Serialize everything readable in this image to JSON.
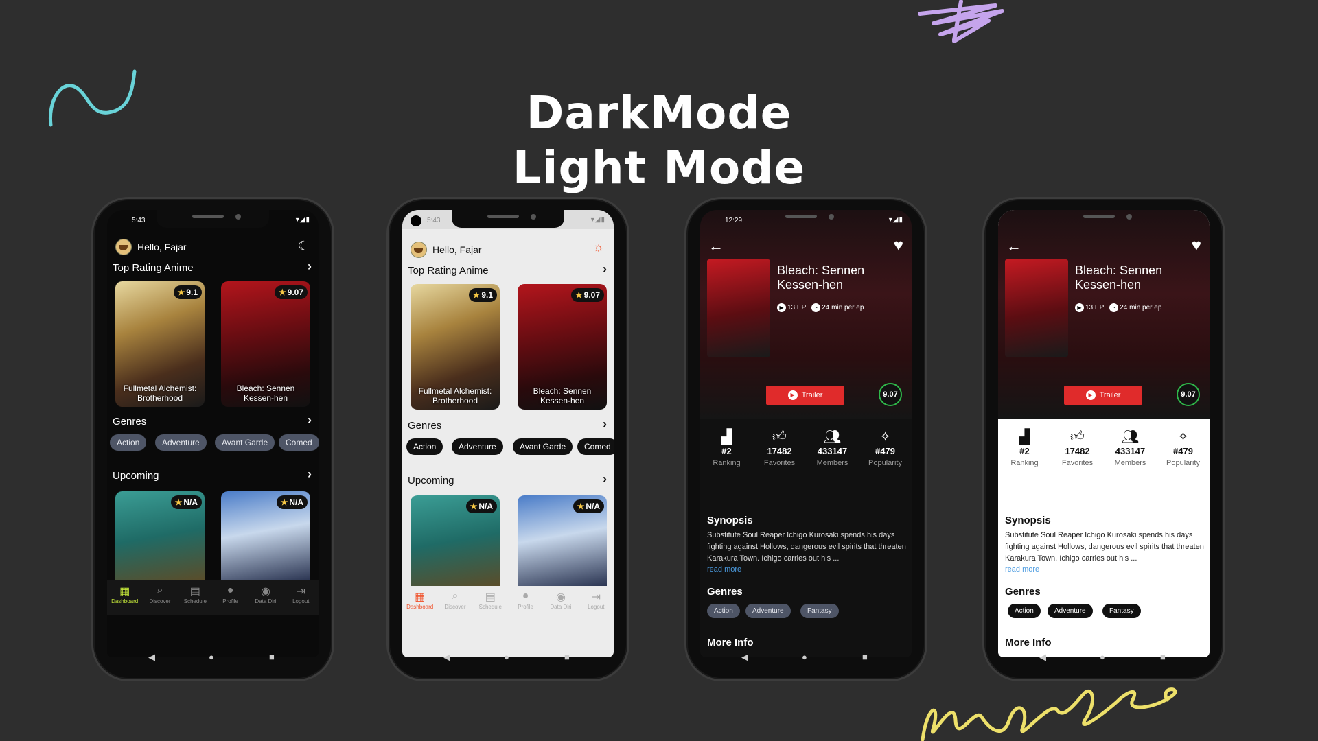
{
  "headline": {
    "line1": "DarkMode",
    "line2": "Light Mode"
  },
  "colors": {
    "background": "#2e2e2e",
    "accent_dark": "#c5e83a",
    "accent_light": "#f0532c",
    "trailer": "#e02b2b",
    "score_ring": "#2fb84a",
    "read_more": "#4b9be0"
  },
  "dashboard": {
    "time": "5:43",
    "greeting": "Hello, Fajar",
    "top_rating_title": "Top Rating Anime",
    "top_rating": [
      {
        "title": "Fullmetal Alchemist: Brotherhood",
        "rating": "9.1"
      },
      {
        "title": "Bleach: Sennen Kessen-hen",
        "rating": "9.07"
      }
    ],
    "genres_title": "Genres",
    "genres": [
      "Action",
      "Adventure",
      "Avant Garde",
      "Comed"
    ],
    "upcoming_title": "Upcoming",
    "upcoming": [
      {
        "rating": "N/A"
      },
      {
        "rating": "N/A"
      }
    ],
    "nav": [
      "Dashboard",
      "Discover",
      "Schedule",
      "Profile",
      "Data Diri",
      "Logout"
    ]
  },
  "detail": {
    "time": "12:29",
    "title": "Bleach: Sennen Kessen-hen",
    "episodes": "13 EP",
    "duration": "24 min per ep",
    "trailer_label": "Trailer",
    "score": "9.07",
    "stats": [
      {
        "value": "#2",
        "label": "Ranking",
        "icon": "bar-chart-icon"
      },
      {
        "value": "17482",
        "label": "Favorites",
        "icon": "thumbs-up-icon"
      },
      {
        "value": "433147",
        "label": "Members",
        "icon": "users-icon"
      },
      {
        "value": "#479",
        "label": "Popularity",
        "icon": "sparkle-icon"
      }
    ],
    "synopsis_title": "Synopsis",
    "synopsis": "Substitute Soul Reaper Ichigo Kurosaki spends his days fighting against Hollows, dangerous evil spirits that threaten Karakura Town. Ichigo carries out his ...",
    "read_more": "read more",
    "genres_title": "Genres",
    "genres": [
      "Action",
      "Adventure",
      "Fantasy"
    ],
    "more_info": "More Info"
  }
}
